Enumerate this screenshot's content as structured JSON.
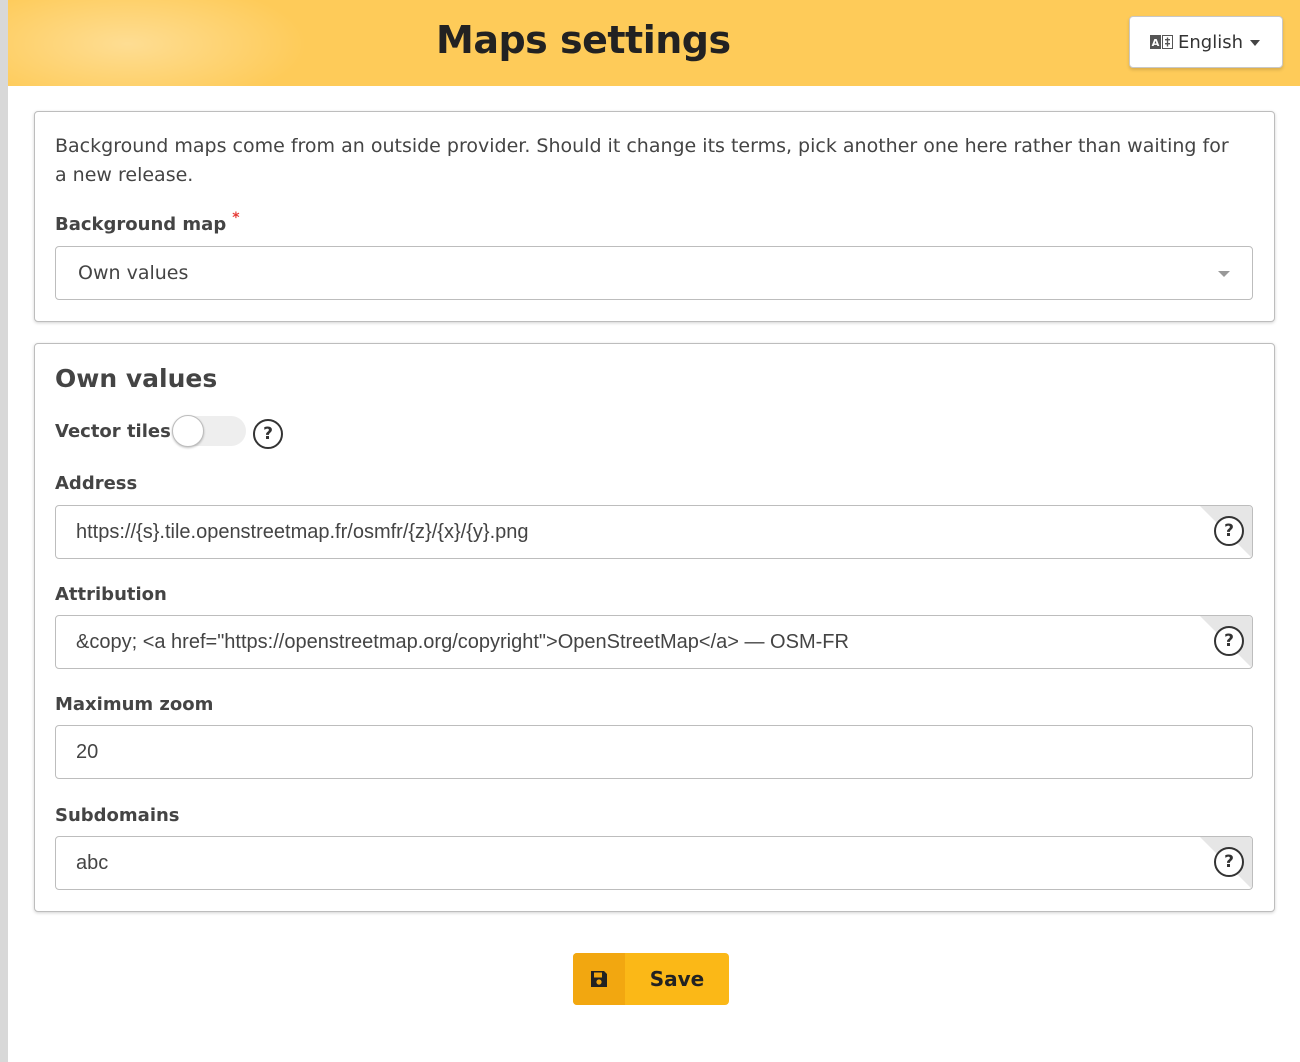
{
  "header": {
    "title": "Maps settings",
    "language": {
      "label": "English",
      "icon": "language-icon"
    },
    "background_color": "#fecb59"
  },
  "provider_card": {
    "intro": "Background maps come from an outside provider. Should it change its terms, pick another one here rather than waiting for a new release.",
    "background_map_label": "Background map",
    "required_marker": "*",
    "background_map_value": "Own values"
  },
  "own_values": {
    "title": "Own values",
    "vector_tiles_label": "Vector tiles",
    "vector_tiles_enabled": false,
    "help_glyph": "?",
    "address_label": "Address",
    "address_value": "https://{s}.tile.openstreetmap.fr/osmfr/{z}/{x}/{y}.png",
    "attribution_label": "Attribution",
    "attribution_value": "&copy; <a href=\"https://openstreetmap.org/copyright\">OpenStreetMap</a> — OSM-FR",
    "max_zoom_label": "Maximum zoom",
    "max_zoom_value": "20",
    "subdomains_label": "Subdomains",
    "subdomains_value": "abc"
  },
  "actions": {
    "save_label": "Save",
    "save_icon": "floppy-disk-icon",
    "accent_color": "#fbb817"
  }
}
